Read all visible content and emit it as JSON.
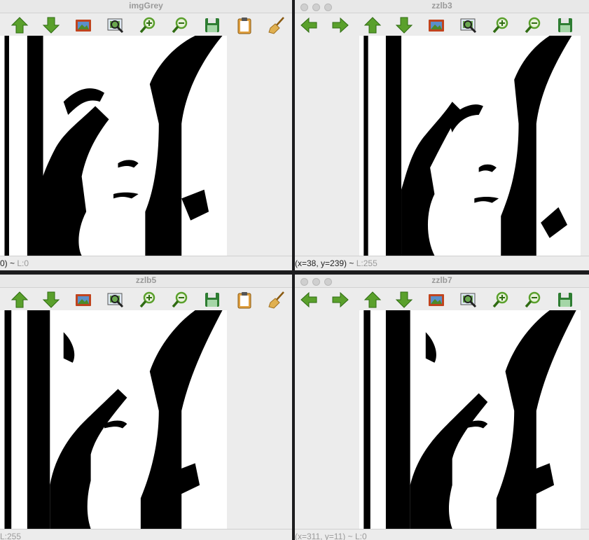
{
  "windows": [
    {
      "title": "imgGrey",
      "status": "0) ~ ",
      "status_level": "L:0"
    },
    {
      "title": "zzlb3",
      "status": "(x=38, y=239) ~ ",
      "status_level": "L:255"
    },
    {
      "title": "zzlb5",
      "status": "",
      "status_level": "L:255"
    },
    {
      "title": "zzlb7",
      "status": "(x=311, y=11) ~ ",
      "status_level": "L:0"
    }
  ],
  "toolbar_icons": {
    "back": "arrow-left-icon",
    "forward": "arrow-right-icon",
    "up": "arrow-up-icon",
    "down": "arrow-down-icon",
    "image": "image-icon",
    "zoom_fit": "zoom-fit-icon",
    "zoom_in": "zoom-in-icon",
    "zoom_out": "zoom-out-icon",
    "save": "save-icon",
    "clipboard": "clipboard-icon",
    "clean": "broom-icon"
  },
  "colors": {
    "toolbar_green": "#5aa02c",
    "save_green": "#2e7d32",
    "window_bg": "#ececec",
    "desktop": "#1c1c1e"
  }
}
